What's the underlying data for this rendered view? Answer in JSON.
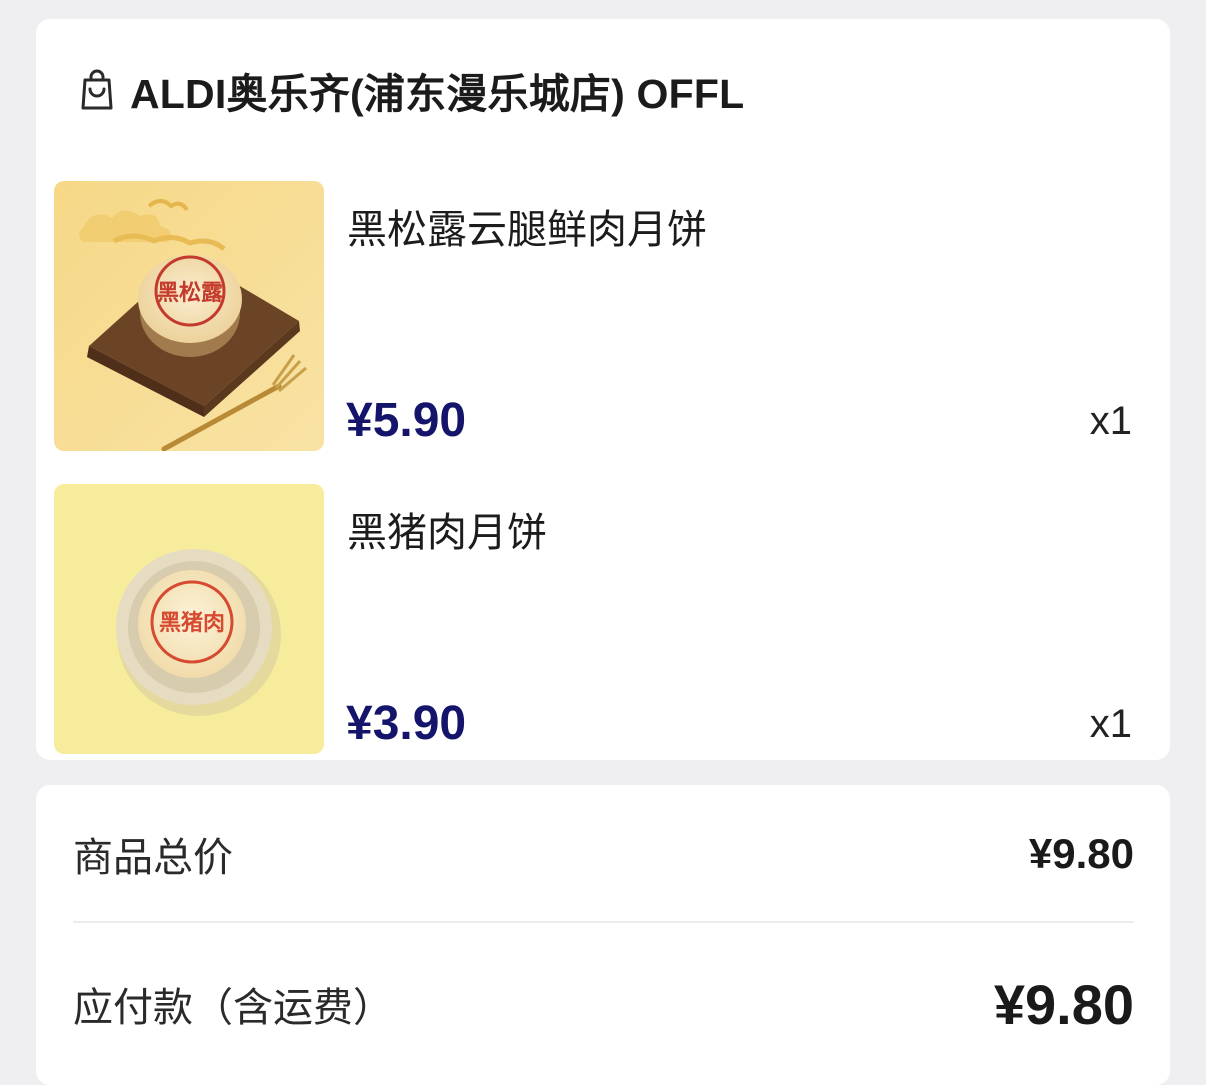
{
  "store": {
    "icon": "shopping-bag-icon",
    "name": "ALDI奥乐齐(浦东漫乐城店) OFFL"
  },
  "items": [
    {
      "name": "黑松露云腿鲜肉月饼",
      "price": "¥5.90",
      "quantity": "x1",
      "stamp_text": "黑松露"
    },
    {
      "name": "黑猪肉月饼",
      "price": "¥3.90",
      "quantity": "x1",
      "stamp_text": "黑猪肉"
    }
  ],
  "summary": {
    "subtotal_label": "商品总价",
    "subtotal_value": "¥9.80",
    "total_label": "应付款（含运费）",
    "total_value": "¥9.80"
  },
  "colors": {
    "price": "#14146b",
    "background": "#efeff1",
    "card": "#ffffff"
  }
}
